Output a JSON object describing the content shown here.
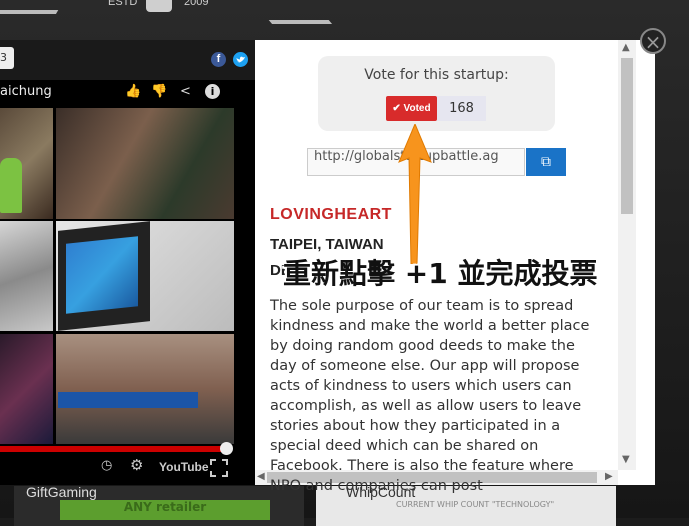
{
  "header": {
    "estd": "ESTD",
    "year": "2009"
  },
  "video": {
    "tab_label": "3",
    "title": "aichung",
    "facebook_label": "f",
    "youtube_label": "YouTube",
    "progress": 0.97
  },
  "vote": {
    "label": "Vote for this startup:",
    "button_label": "✔ Voted",
    "count": "168"
  },
  "share": {
    "url": "http://globalstartupbattle.ag"
  },
  "startup": {
    "name": "LOVINGHEART",
    "location": "TAIPEI, TAIWAN",
    "desc_heading": "DE",
    "description": "The sole purpose of our team is to spread kindness and make the world a better place by doing random good deeds to make the day of someone else. Our app will propose acts of kindness to users which users can accomplish, as well as allow users to leave stories about how they participated in a special deed which can be shared on Facebook. There is also the feature where NPO and companies can post"
  },
  "annotation": {
    "text": "重新點擊 +1 並完成投票"
  },
  "bottom": {
    "left_title": "GiftGaming",
    "left_banner": "ANY retailer",
    "right_title": "WhipCount",
    "right_sub": "CURRENT WHIP COUNT \"TECHNOLOGY\""
  },
  "colors": {
    "voted": "#d82b2b",
    "accent": "#1a73c7",
    "name": "#c62828",
    "arrow": "#f7941d"
  },
  "icons": [
    "thumbs-up-icon",
    "thumbs-down-icon",
    "share-icon",
    "info-icon",
    "clock-icon",
    "gear-icon",
    "fullscreen-icon",
    "copy-icon",
    "close-icon"
  ]
}
